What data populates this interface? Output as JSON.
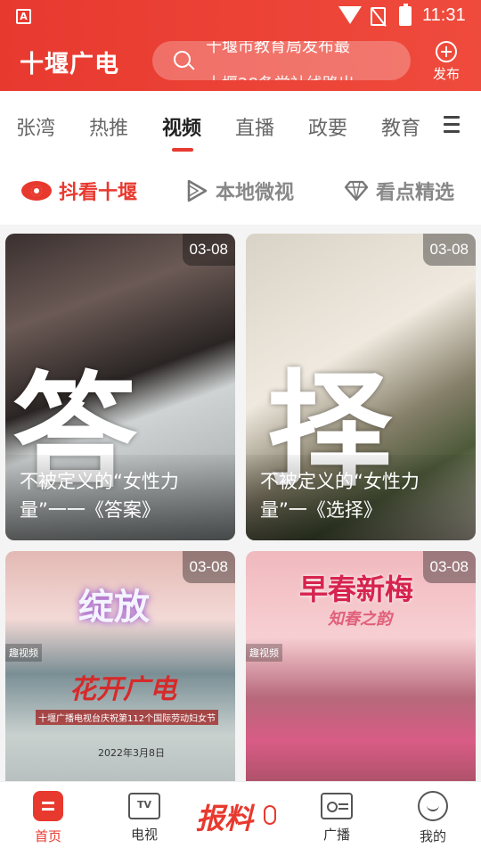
{
  "status_bar": {
    "time": "11:31",
    "app_icon": "A"
  },
  "header": {
    "title": "十堰广电",
    "search_lines": [
      "十堰市教育局发布最",
      "十堰28条党社线路出"
    ],
    "publish_label": "发布"
  },
  "tabs": [
    {
      "label": "张湾",
      "active": false
    },
    {
      "label": "热推",
      "active": false
    },
    {
      "label": "视频",
      "active": true
    },
    {
      "label": "直播",
      "active": false
    },
    {
      "label": "政要",
      "active": false
    },
    {
      "label": "教育",
      "active": false
    }
  ],
  "subcats": [
    {
      "label": "抖看十堰",
      "icon": "eye-icon",
      "active": true
    },
    {
      "label": "本地微视",
      "icon": "play-icon",
      "active": false
    },
    {
      "label": "看点精选",
      "icon": "diamond-icon",
      "active": false
    }
  ],
  "cards": [
    {
      "date": "03-08",
      "caption": "不被定义的“女性力量”一一《答案》",
      "overlay_char": "答"
    },
    {
      "date": "03-08",
      "caption": "不被定义的“女性力量”一《选择》",
      "overlay_char": "择"
    },
    {
      "date": "03-08",
      "caption": "",
      "art_text": "绽放",
      "art_sub": "花开广电",
      "art_small": "十堰广播电视台庆祝第112个国际劳动妇女节",
      "art_date": "2022年3月8日",
      "logo": "趣视频"
    },
    {
      "date": "03-08",
      "caption": "",
      "art_text": "早春新梅",
      "art_sub": "知春之韵",
      "logo": "趣视频"
    }
  ],
  "bottom_nav": {
    "home": "首页",
    "tv": "电视",
    "report": "报料",
    "radio": "广播",
    "mine": "我的",
    "tv_icon_text": "TV"
  },
  "colors": {
    "accent": "#e8392f",
    "header_bg": "#ef4b3d"
  }
}
